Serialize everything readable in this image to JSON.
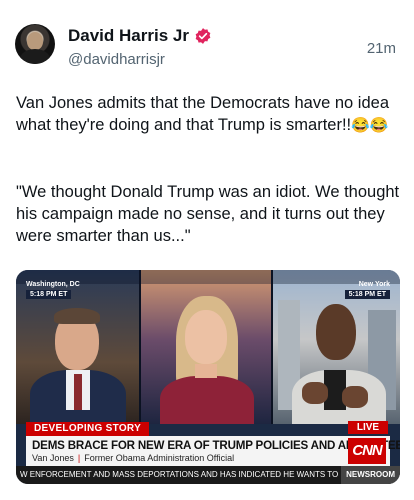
{
  "post": {
    "display_name": "David Harris Jr",
    "handle": "@davidharrisjr",
    "timestamp": "21m",
    "verified_badge_color": "#e0245e",
    "paragraph1": "Van Jones admits that the Democrats have no idea what they're doing and that Trump is smarter!!",
    "paragraph1_emoji": "😂😂",
    "paragraph2": "\"We thought Donald Trump was an idiot. We thought his campaign made no sense, and it turns out they were smarter than us...\""
  },
  "media": {
    "left_location": "Washington, DC",
    "left_time": "5:18 PM ET",
    "right_location": "New York",
    "right_time": "5:18 PM ET",
    "developing": "DEVELOPING STORY",
    "live": "LIVE",
    "headline": "DEMS BRACE FOR NEW ERA OF TRUMP POLICIES AND APPOINTEES",
    "guest_name": "Van Jones",
    "guest_title": "Former Obama Administration Official",
    "network_logo": "CNN",
    "ticker": "W ENFORCEMENT AND MASS DEPORTATIONS AND HAS INDICATED HE WANTS TO STAC",
    "ticker_tag": "NEWSROOM",
    "brand_red": "#cc0000"
  }
}
